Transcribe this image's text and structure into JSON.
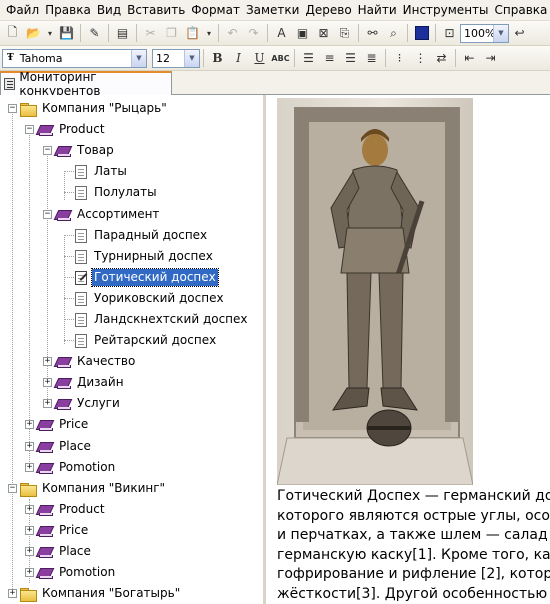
{
  "menu": [
    "Файл",
    "Правка",
    "Вид",
    "Вставить",
    "Формат",
    "Заметки",
    "Дерево",
    "Найти",
    "Инструменты",
    "Справка"
  ],
  "toolbar": {
    "zoom": "100%",
    "font_name": "Tahoma",
    "font_size": "12",
    "bold_label": "B",
    "italic_label": "I",
    "underline_label": "U",
    "strike_label": "ABC"
  },
  "tab": {
    "label": "Мониторинг конкурентов"
  },
  "tree": {
    "company1": "Компания \"Рыцарь\"",
    "product": "Product",
    "tovar": "Товар",
    "laty": "Латы",
    "polulaty": "Полулаты",
    "assortiment": "Ассортимент",
    "paradny": "Парадный доспех",
    "turnirny": "Турнирный доспех",
    "gotichesky": "Готический доспех",
    "urikovsky": "Уориковский доспех",
    "landsknecht": "Ландскнехтский доспех",
    "reitarsky": "Рейтарский доспех",
    "kachestvo": "Качество",
    "dizain": "Дизайн",
    "uslugi": "Услуги",
    "price": "Price",
    "place": "Place",
    "pomotion": "Pomotion",
    "company2": "Компания \"Викинг\"",
    "product2": "Product",
    "price2": "Price",
    "place2": "Place",
    "pomotion2": "Pomotion",
    "company3": "Компания \"Богатырь\""
  },
  "content": {
    "image_desc": "Gothic armour effigy",
    "lines": [
      "Готический Доспех — германский до",
      "которого являются острые углы, осо",
      "и перчатках, а также шлем — салад",
      "германскую каску[1]. Кроме того, ка",
      "гофрирование и рифление [2], котор",
      "жёсткости[3]. Другой особенностью"
    ]
  },
  "colors": {
    "selection": "#316ac5",
    "tab_accent": "#e68b2c",
    "menubar": "#f3f1ea"
  }
}
